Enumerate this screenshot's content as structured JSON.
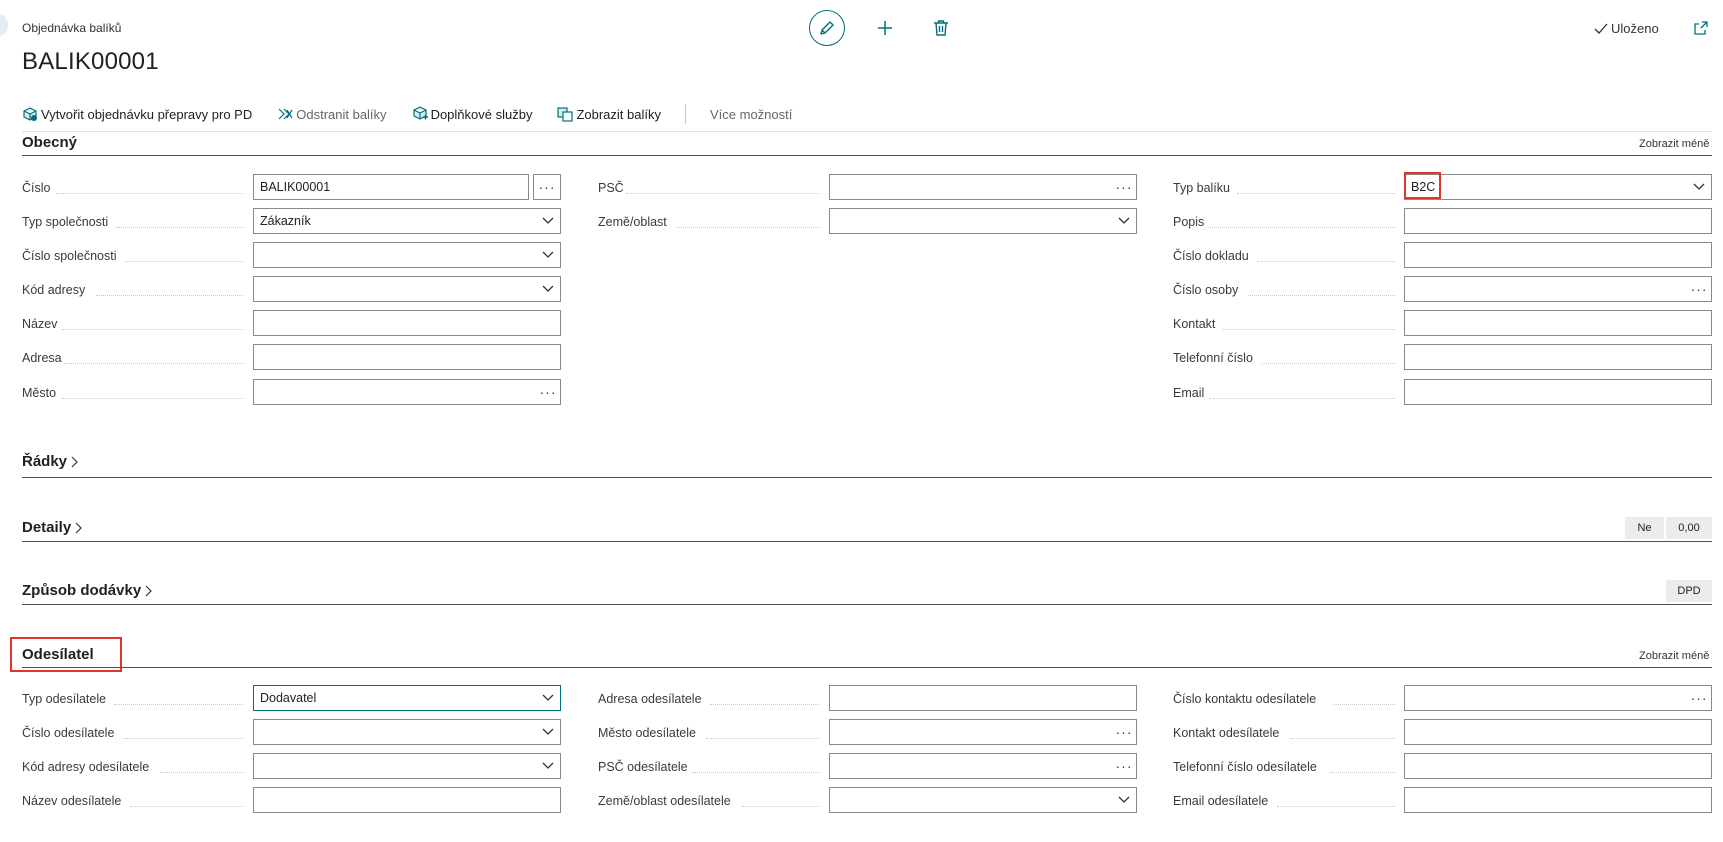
{
  "header": {
    "breadcrumb": "Objednávka balíků",
    "title": "BALIK00001",
    "saved_label": "Uloženo"
  },
  "actions": [
    {
      "label": "Vytvořit objednávku přepravy pro PD",
      "icon": "create-shipment-icon",
      "enabled": true
    },
    {
      "label": "Odstranit balíky",
      "icon": "remove-packages-icon",
      "enabled": false
    },
    {
      "label": "Doplňkové služby",
      "icon": "additional-services-icon",
      "enabled": true
    },
    {
      "label": "Zobrazit balíky",
      "icon": "show-packages-icon",
      "enabled": true
    }
  ],
  "more_actions_label": "Více možností",
  "sections": {
    "general": {
      "title": "Obecný",
      "show_less": "Zobrazit méně",
      "col1": [
        {
          "label": "Číslo",
          "value": "BALIK00001",
          "control": "text+ellipsis"
        },
        {
          "label": "Typ společnosti",
          "value": "Zákazník",
          "control": "dropdown"
        },
        {
          "label": "Číslo společnosti",
          "value": "",
          "control": "dropdown"
        },
        {
          "label": "Kód adresy",
          "value": "",
          "control": "dropdown"
        },
        {
          "label": "Název",
          "value": "",
          "control": "text"
        },
        {
          "label": "Adresa",
          "value": "",
          "control": "text"
        },
        {
          "label": "Město",
          "value": "",
          "control": "lookup"
        }
      ],
      "col2": [
        {
          "label": "PSČ",
          "value": "",
          "control": "lookup"
        },
        {
          "label": "Země/oblast",
          "value": "",
          "control": "dropdown"
        }
      ],
      "col3": [
        {
          "label": "Typ balíku",
          "value": "B2C",
          "control": "dropdown"
        },
        {
          "label": "Popis",
          "value": "",
          "control": "text"
        },
        {
          "label": "Číslo dokladu",
          "value": "",
          "control": "text"
        },
        {
          "label": "Číslo osoby",
          "value": "",
          "control": "lookup"
        },
        {
          "label": "Kontakt",
          "value": "",
          "control": "text"
        },
        {
          "label": "Telefonní číslo",
          "value": "",
          "control": "text"
        },
        {
          "label": "Email",
          "value": "",
          "control": "text"
        }
      ]
    },
    "lines": {
      "title": "Řádky"
    },
    "details": {
      "title": "Detaily",
      "badges": [
        "Ne",
        "0,00"
      ]
    },
    "delivery": {
      "title": "Způsob dodávky",
      "badges": [
        "DPD"
      ]
    },
    "sender": {
      "title": "Odesílatel",
      "show_less": "Zobrazit méně",
      "col1": [
        {
          "label": "Typ odesílatele",
          "value": "Dodavatel",
          "control": "dropdown"
        },
        {
          "label": "Číslo odesílatele",
          "value": "",
          "control": "dropdown"
        },
        {
          "label": "Kód adresy odesílatele",
          "value": "",
          "control": "dropdown"
        },
        {
          "label": "Název odesílatele",
          "value": "",
          "control": "text"
        }
      ],
      "col2": [
        {
          "label": "Adresa odesílatele",
          "value": "",
          "control": "text"
        },
        {
          "label": "Město odesílatele",
          "value": "",
          "control": "lookup"
        },
        {
          "label": "PSČ odesílatele",
          "value": "",
          "control": "lookup"
        },
        {
          "label": "Země/oblast odesílatele",
          "value": "",
          "control": "dropdown"
        }
      ],
      "col3": [
        {
          "label": "Číslo kontaktu odesílatele",
          "value": "",
          "control": "lookup"
        },
        {
          "label": "Kontakt odesílatele",
          "value": "",
          "control": "text"
        },
        {
          "label": "Telefonní číslo odesílatele",
          "value": "",
          "control": "text"
        },
        {
          "label": "Email odesílatele",
          "value": "",
          "control": "text"
        }
      ]
    }
  },
  "colors": {
    "accent": "#00707a",
    "highlight": "#e0342c",
    "rule": "#505050"
  }
}
